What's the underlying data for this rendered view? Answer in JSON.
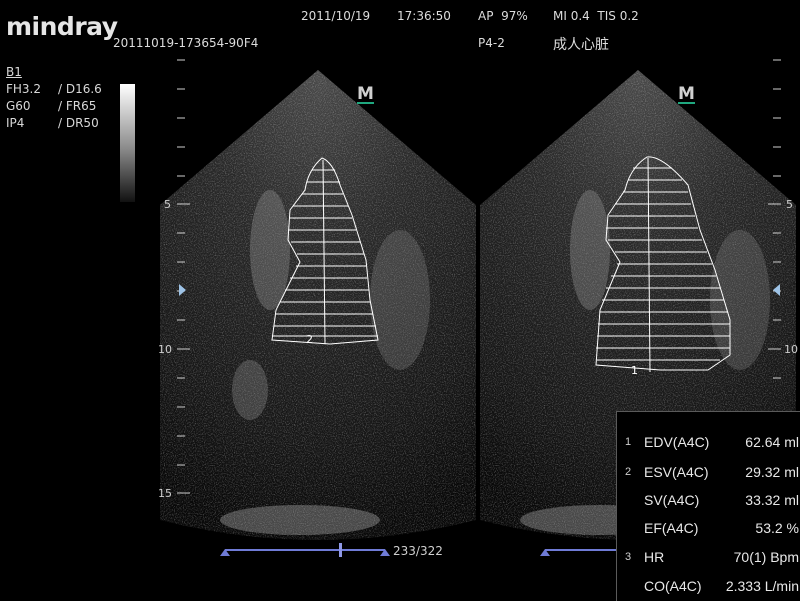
{
  "header": {
    "brand": "mindray",
    "date": "2011/10/19",
    "time": "17:36:50",
    "ap": "AP  97%",
    "mi_tis": "MI 0.4  TIS 0.2",
    "file_id": "20111019-173654-90F4",
    "probe": "P4-2",
    "exam": "成人心脏"
  },
  "params": {
    "mode": "B1",
    "rows": [
      {
        "left": "FH3.2",
        "right": "/ D16.6"
      },
      {
        "left": "G60",
        "right": "/ FR65"
      },
      {
        "left": "IP4",
        "right": "/ DR50"
      }
    ]
  },
  "depth_scale": {
    "labels": [
      "5",
      "10",
      "15"
    ]
  },
  "orientation_marker": "M",
  "contour_labels": {
    "left": "2",
    "right": "1"
  },
  "cine": {
    "frame": "233/322"
  },
  "measurements": [
    {
      "index": "1",
      "name": "EDV(A4C)",
      "value": "62.64 ml"
    },
    {
      "index": "2",
      "name": "ESV(A4C)",
      "value": "29.32 ml"
    },
    {
      "index": "",
      "name": "SV(A4C)",
      "value": "33.32 ml"
    },
    {
      "index": "",
      "name": "EF(A4C)",
      "value": "53.2 %"
    },
    {
      "index": "3",
      "name": "HR",
      "value": "70(1) Bpm"
    },
    {
      "index": "",
      "name": "CO(A4C)",
      "value": "2.333 L/min"
    }
  ],
  "colors": {
    "accent_green": "#1fa87f",
    "marker_blue": "#9ec3e6",
    "cine_bar": "#6f7bd6"
  }
}
